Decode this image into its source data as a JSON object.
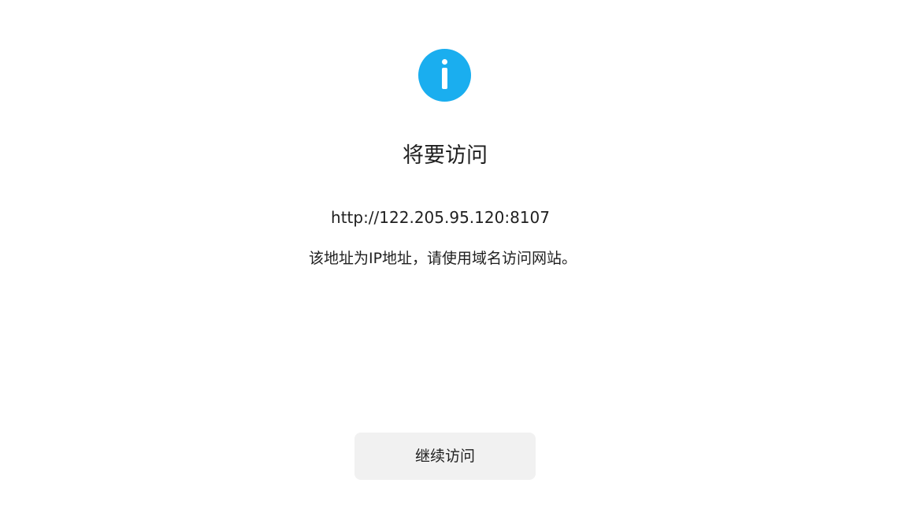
{
  "dialog": {
    "icon": "info-icon",
    "title": "将要访问",
    "url": "http://122.205.95.120:8107",
    "message": "该地址为IP地址，请使用域名访问网站。",
    "continue_label": "继续访问"
  },
  "colors": {
    "accent": "#1aaeef",
    "button_bg": "#f1f1f1",
    "text": "#1f1f1f",
    "background": "#ffffff"
  }
}
